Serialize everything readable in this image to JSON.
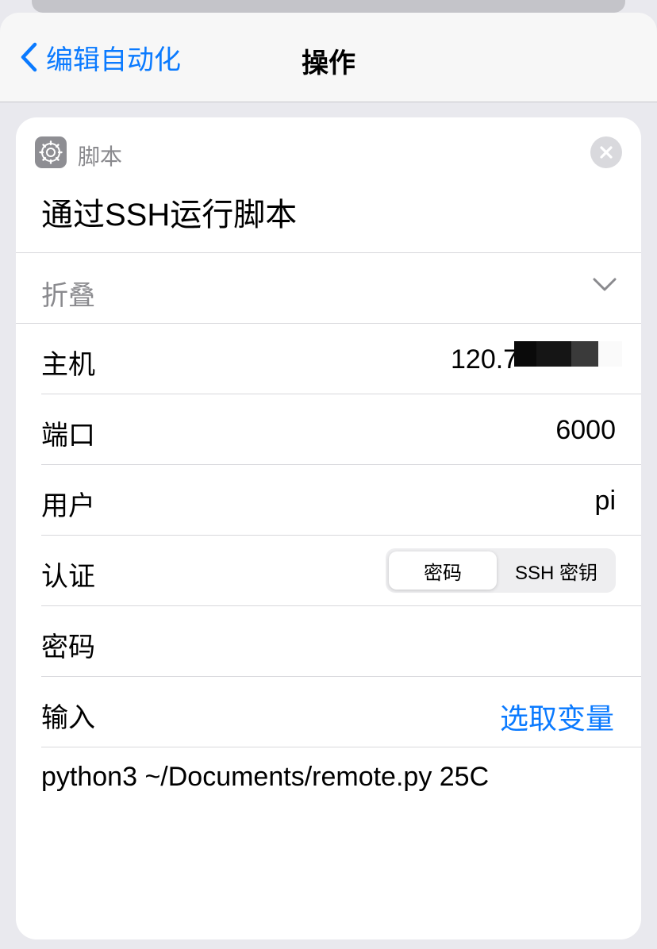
{
  "nav": {
    "back_label": "编辑自动化",
    "title": "操作"
  },
  "action": {
    "category": "脚本",
    "title": "通过SSH运行脚本",
    "collapse_label": "折叠",
    "icon": "gear-icon"
  },
  "fields": {
    "host": {
      "label": "主机",
      "value": "120.7"
    },
    "port": {
      "label": "端口",
      "value": "6000"
    },
    "user": {
      "label": "用户",
      "value": "pi"
    },
    "auth": {
      "label": "认证",
      "options": [
        "密码",
        "SSH 密钥"
      ],
      "selected": "密码"
    },
    "password": {
      "label": "密码",
      "value": ""
    },
    "input": {
      "label": "输入",
      "action": "选取变量"
    }
  },
  "script": "python3 ~/Documents/remote.py 25C",
  "colors": {
    "accent": "#0a7aff",
    "secondary_text": "#8a8a8e",
    "background": "#e9e9ee"
  }
}
